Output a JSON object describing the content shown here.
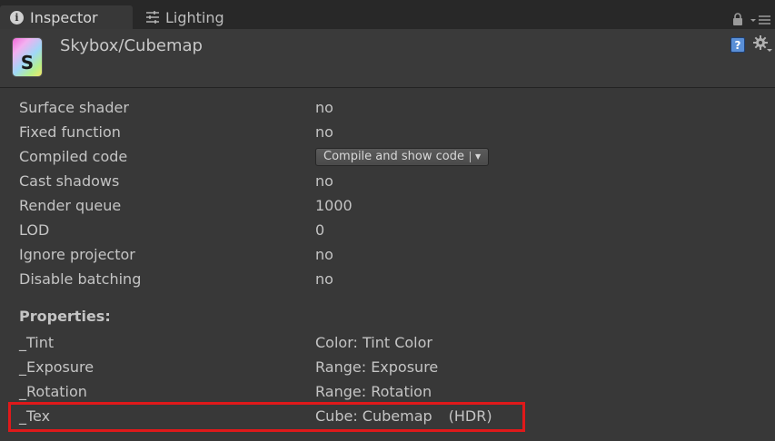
{
  "tabs": {
    "inspector": "Inspector",
    "lighting": "Lighting"
  },
  "header": {
    "title": "Skybox/Cubemap",
    "icon_letter": "S",
    "help_glyph": "?"
  },
  "info": [
    {
      "label": "Surface shader",
      "value": "no"
    },
    {
      "label": "Fixed function",
      "value": "no"
    },
    {
      "label": "Compiled code",
      "button": "Compile and show code"
    },
    {
      "label": "Cast shadows",
      "value": "no"
    },
    {
      "label": "Render queue",
      "value": "1000"
    },
    {
      "label": "LOD",
      "value": "0"
    },
    {
      "label": "Ignore projector",
      "value": "no"
    },
    {
      "label": "Disable batching",
      "value": "no"
    }
  ],
  "properties": {
    "title": "Properties:",
    "items": [
      {
        "name": "_Tint",
        "type": "Color: Tint Color"
      },
      {
        "name": "_Exposure",
        "type": "Range: Exposure"
      },
      {
        "name": "_Rotation",
        "type": "Range: Rotation"
      },
      {
        "name": "_Tex",
        "type": "Cube: Cubemap",
        "tag": "(HDR)"
      }
    ]
  },
  "colors": {
    "highlight": "#e0191a",
    "background": "#383838",
    "tabbar": "#282828"
  }
}
